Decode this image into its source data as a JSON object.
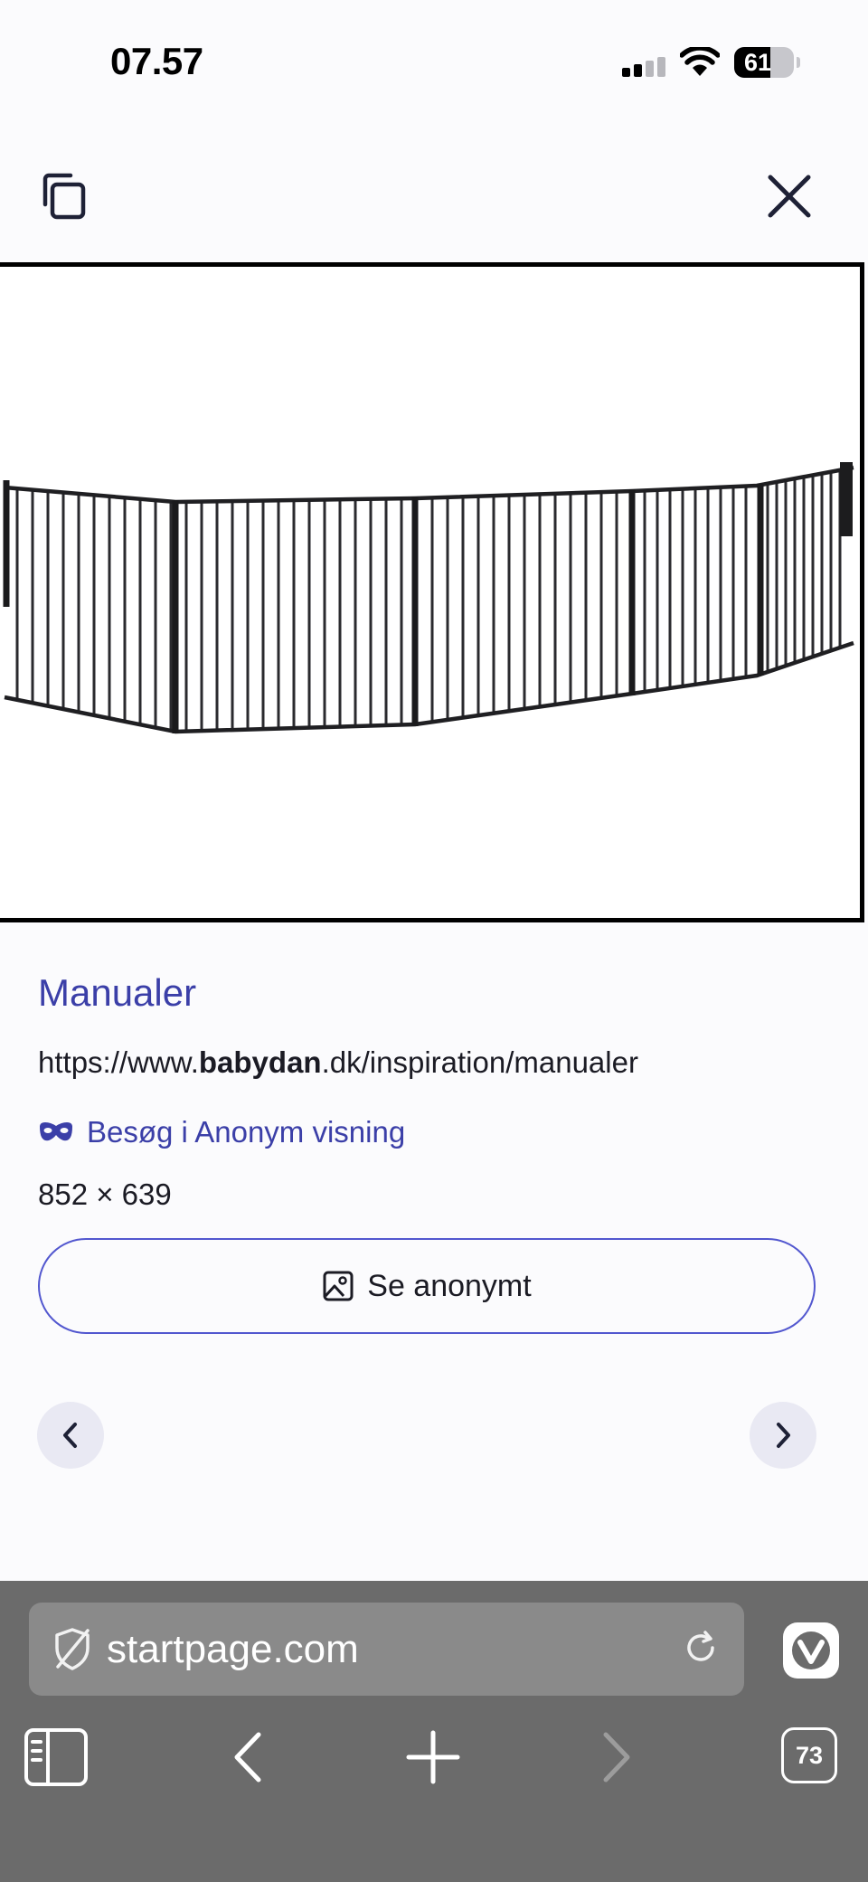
{
  "status_bar": {
    "time": "07.57",
    "battery_level": 61,
    "battery_text": "61",
    "icons": [
      "signal-icon",
      "wifi-icon",
      "battery-icon"
    ]
  },
  "toolbar": {
    "icons": [
      "copy-icon",
      "close-icon"
    ]
  },
  "image_viewer": {
    "image_description_icon": "baby-gate-image"
  },
  "result": {
    "title": "Manualer",
    "url_prefix": "https://www.",
    "url_domain": "babydan",
    "url_suffix": ".dk/inspiration/manualer",
    "anon_link_label": "Besøg i Anonym visning",
    "dimensions": "852 × 639",
    "view_button_label": "Se anonymt"
  },
  "browser": {
    "address": "startpage.com",
    "tab_count": "73",
    "icons": [
      "shield-slash-icon",
      "reload-icon",
      "vivaldi-icon",
      "panel-icon",
      "back-arrow-icon",
      "plus-icon",
      "forward-arrow-icon"
    ]
  },
  "colors": {
    "accent": "#3b3fa8",
    "button_border": "#5257cf",
    "bottom_bar": "#6b6b6b",
    "address_bar": "#8a8a8a",
    "nav_circle": "#e9e9f3"
  }
}
